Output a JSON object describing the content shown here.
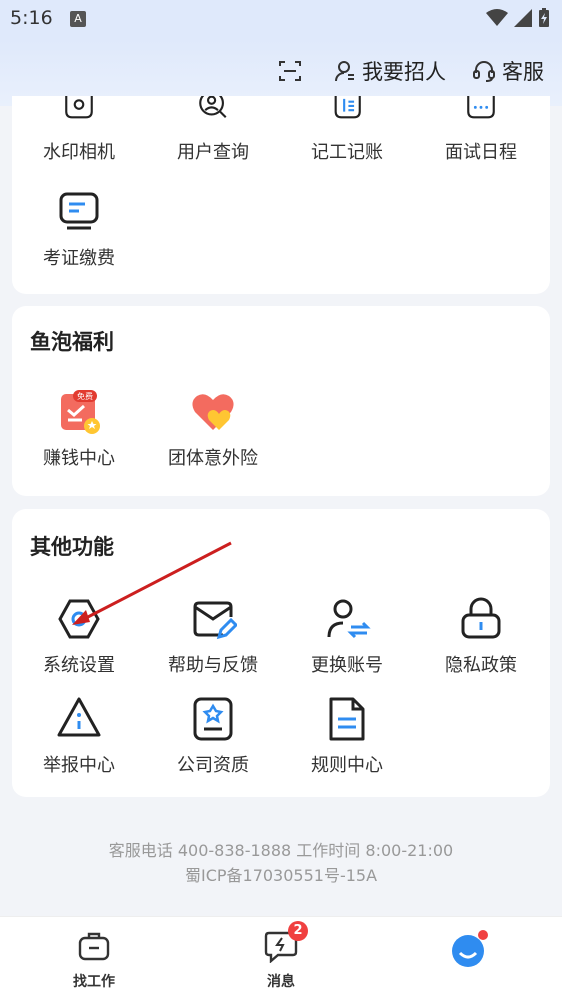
{
  "status": {
    "time": "5:16",
    "a_icon": "A"
  },
  "header": {
    "actions": [
      {
        "label": "",
        "icon": "scan-icon"
      },
      {
        "label": "我要招人",
        "icon": "person-icon"
      },
      {
        "label": "客服",
        "icon": "headset-icon"
      }
    ]
  },
  "tools_card": {
    "items": [
      {
        "label": "水印相机",
        "icon": "camera-icon"
      },
      {
        "label": "用户查询",
        "icon": "user-search-icon"
      },
      {
        "label": "记工记账",
        "icon": "ledger-icon"
      },
      {
        "label": "面试日程",
        "icon": "calendar-icon"
      },
      {
        "label": "考证缴费",
        "icon": "monitor-icon"
      }
    ]
  },
  "benefits_card": {
    "title": "鱼泡福利",
    "items": [
      {
        "label": "赚钱中心",
        "icon": "earn-icon",
        "badge": "免费"
      },
      {
        "label": "团体意外险",
        "icon": "heart-icon"
      }
    ]
  },
  "other_card": {
    "title": "其他功能",
    "items": [
      {
        "label": "系统设置",
        "icon": "settings-icon"
      },
      {
        "label": "帮助与反馈",
        "icon": "feedback-icon"
      },
      {
        "label": "更换账号",
        "icon": "switch-account-icon"
      },
      {
        "label": "隐私政策",
        "icon": "lock-icon"
      },
      {
        "label": "举报中心",
        "icon": "report-icon"
      },
      {
        "label": "公司资质",
        "icon": "certificate-icon"
      },
      {
        "label": "规则中心",
        "icon": "rules-icon"
      }
    ]
  },
  "footer": {
    "service_line": "客服电话 400-838-1888 工作时间 8:00-21:00",
    "icp": "蜀ICP备17030551号-15A"
  },
  "bottom_nav": {
    "items": [
      {
        "label": "找工作",
        "icon": "briefcase-icon"
      },
      {
        "label": "消息",
        "icon": "message-icon",
        "badge": "2"
      },
      {
        "label": "",
        "icon": "profile-icon"
      }
    ]
  },
  "colors": {
    "accent": "#2f8cf0",
    "badge": "#f04040",
    "arrow": "#cc1f1f"
  }
}
